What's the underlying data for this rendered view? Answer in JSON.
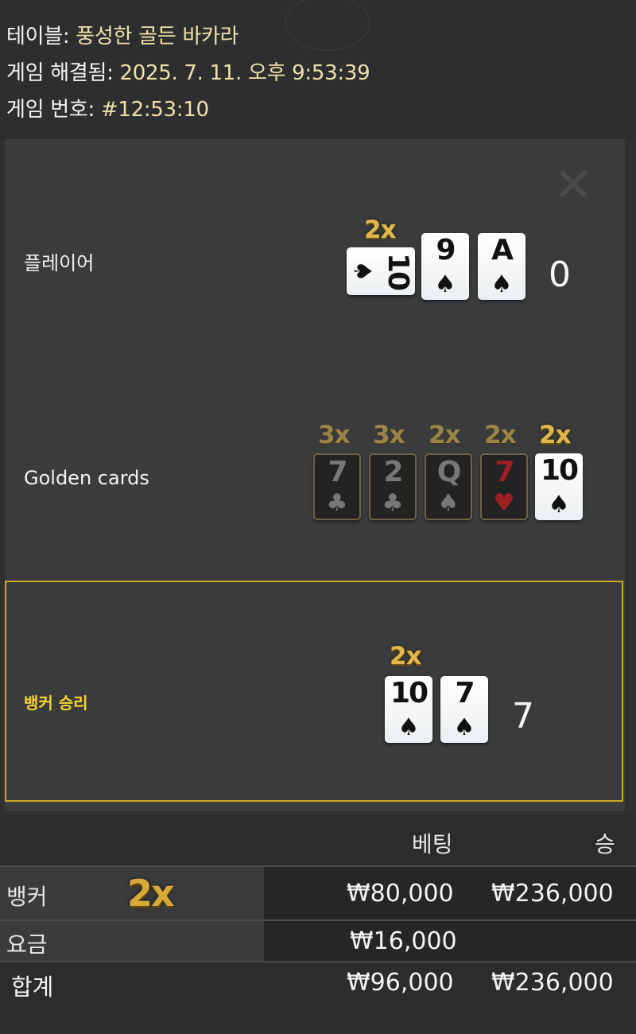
{
  "header": {
    "table_label": "테이블:",
    "table_name": "풍성한 골든 바카라",
    "resolved_label": "게임 해결됨:",
    "resolved_time": "2025. 7. 11. 오후 9:53:39",
    "game_no_label": "게임 번호:",
    "game_no": "#12:53:10"
  },
  "rows": {
    "player": {
      "label": "플레이어",
      "multiplier": "2x",
      "cards": [
        {
          "rank": "10",
          "suit": "♠",
          "color": "black",
          "sideways": true
        },
        {
          "rank": "9",
          "suit": "♠",
          "color": "black"
        },
        {
          "rank": "A",
          "suit": "♠",
          "color": "black"
        }
      ],
      "score": "0"
    },
    "golden": {
      "label": "Golden cards",
      "cards": [
        {
          "mult": "3x",
          "rank": "7",
          "suit": "♣",
          "style": "dark"
        },
        {
          "mult": "3x",
          "rank": "2",
          "suit": "♣",
          "style": "dark"
        },
        {
          "mult": "2x",
          "rank": "Q",
          "suit": "♠",
          "style": "dark"
        },
        {
          "mult": "2x",
          "rank": "7",
          "suit": "♥",
          "style": "dark-red"
        },
        {
          "mult": "2x",
          "rank": "10",
          "suit": "♠",
          "style": "light"
        }
      ]
    },
    "banker": {
      "label": "뱅커 승리",
      "multiplier": "2x",
      "cards": [
        {
          "rank": "10",
          "suit": "♠",
          "color": "black"
        },
        {
          "rank": "7",
          "suit": "♠",
          "color": "black"
        }
      ],
      "score": "7"
    }
  },
  "bets": {
    "col_bet": "베팅",
    "col_win": "승",
    "rows": [
      {
        "name": "뱅커",
        "mult": "2x",
        "bet": "₩80,000",
        "win": "₩236,000"
      },
      {
        "name": "요금",
        "bet": "₩16,000",
        "win": ""
      }
    ],
    "total": {
      "name": "합계",
      "bet": "₩96,000",
      "win": "₩236,000"
    }
  },
  "colors": {
    "accent_gold": "#e1b74b",
    "banker_border": "#c9ad1d",
    "banker_label": "#f6d32c"
  }
}
